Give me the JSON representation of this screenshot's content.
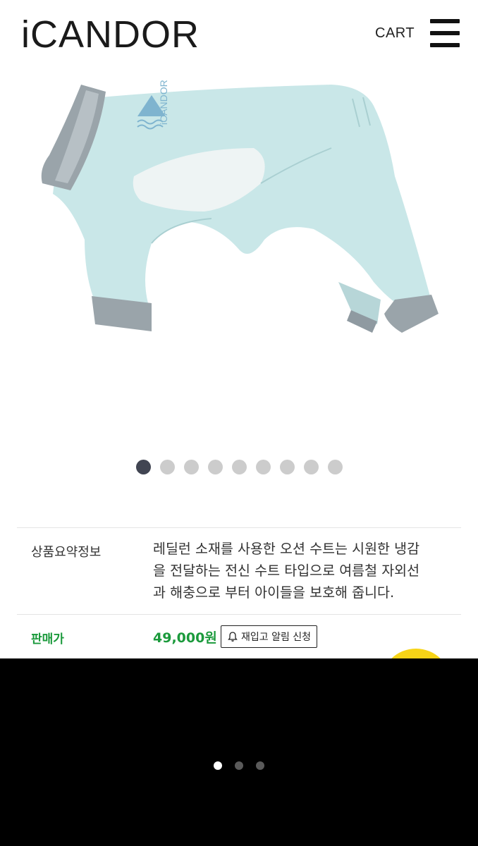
{
  "header": {
    "logo": "iCANDOR",
    "cart_label": "CART",
    "menu_icon": "hamburger-menu-icon"
  },
  "product": {
    "image_description_icon": "dog-suit-image",
    "shirt_logo": "iCANDOR",
    "colors": {
      "suit": "#c9e7e8",
      "cuff": "#9aa4aa",
      "mesh": "#eef4f4",
      "logo": "#7fb4cf"
    }
  },
  "carousel": {
    "count": 9,
    "active_index": 0
  },
  "info": {
    "summary_label": "상품요약정보",
    "summary_lines": [
      "레딜런 소재를 사용한 오션 수트는 시원한 냉감",
      "을 전달하는 전신 수트 타입으로 여름철 자외선",
      "과 해충으로 부터 아이들을 보호해 줍니다."
    ],
    "price_label": "판매가",
    "price": "49,000원",
    "restock_label": "재입고 알림 신청",
    "restock_icon": "bell-icon",
    "price_color": "#1b9a3c"
  },
  "overlay": {
    "count": 3,
    "active_index": 0
  }
}
